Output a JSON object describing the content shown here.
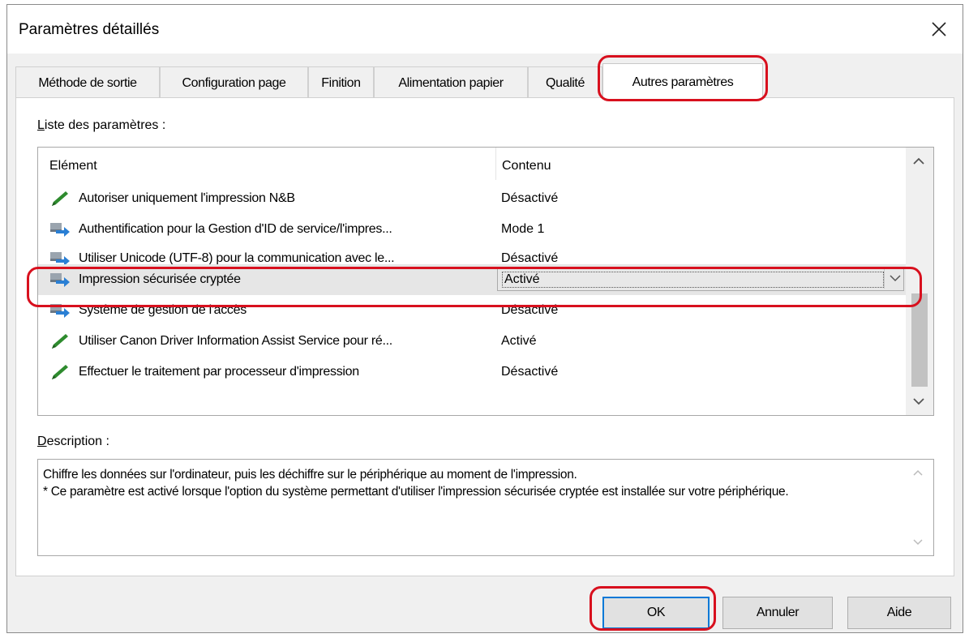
{
  "window": {
    "title": "Paramètres détaillés"
  },
  "tabs": [
    {
      "label": "Méthode de sortie"
    },
    {
      "label": "Configuration page"
    },
    {
      "label": "Finition"
    },
    {
      "label": "Alimentation papier"
    },
    {
      "label": "Qualité"
    },
    {
      "label": "Autres paramètres"
    }
  ],
  "settings_list": {
    "label_key": "L",
    "label_rest": "iste des paramètres :",
    "col_item": "Elément",
    "col_content": "Contenu",
    "rows": [
      {
        "name": "Autoriser uniquement l'impression N&B",
        "value": "Désactivé",
        "icon": "pencil-icon"
      },
      {
        "name": "Authentification pour la Gestion d'ID de service/l'impres...",
        "value": "Mode 1",
        "icon": "printer-arrow-icon"
      },
      {
        "name": "Utiliser Unicode (UTF-8) pour la communication avec le...",
        "value": "Désactivé",
        "icon": "printer-arrow-icon"
      },
      {
        "name": "Impression sécurisée cryptée",
        "value": "Activé",
        "icon": "printer-arrow-icon"
      },
      {
        "name": "Système de gestion de l'accès",
        "value": "Désactivé",
        "icon": "printer-arrow-icon"
      },
      {
        "name": "Utiliser Canon Driver Information Assist Service pour ré...",
        "value": "Activé",
        "icon": "pencil-icon"
      },
      {
        "name": "Effectuer le traitement par processeur d'impression",
        "value": "Désactivé",
        "icon": "pencil-icon"
      }
    ]
  },
  "description": {
    "label_key": "D",
    "label_rest": "escription :",
    "text": "Chiffre les données sur l'ordinateur, puis les déchiffre sur le périphérique au moment de l'impression.\n* Ce paramètre est activé lorsque l'option du système permettant d'utiliser l'impression sécurisée cryptée est installée sur votre périphérique."
  },
  "buttons": {
    "ok": "OK",
    "cancel": "Annuler",
    "help": "Aide"
  },
  "colors": {
    "highlight": "#d8101e",
    "pencil": "#2e8b2e",
    "arrow": "#2a7fd4"
  }
}
